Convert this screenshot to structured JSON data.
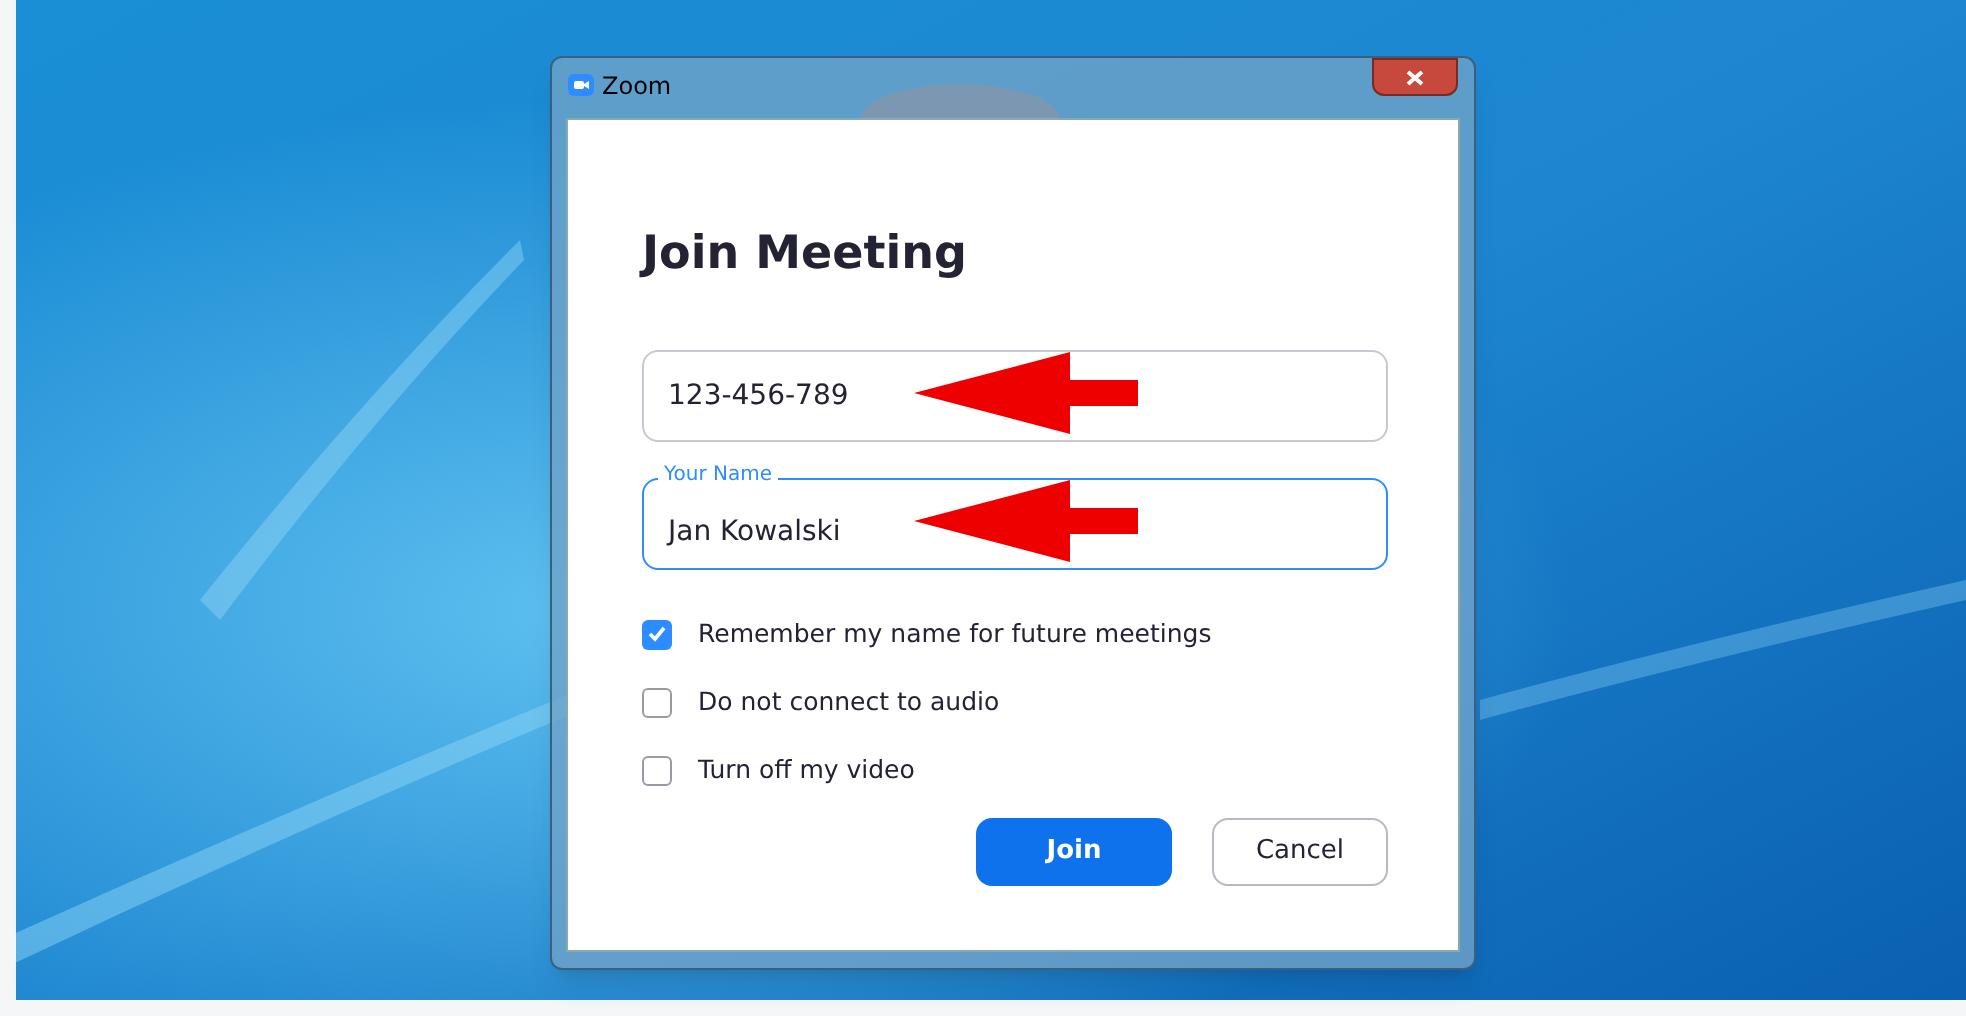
{
  "window": {
    "title": "Zoom"
  },
  "heading": "Join Meeting",
  "fields": [
    {
      "kind": "plain",
      "value": "123-456-789",
      "focused": false
    },
    {
      "kind": "labeled",
      "label": "Your Name",
      "value": "Jan Kowalski",
      "focused": true
    }
  ],
  "options": [
    {
      "label": "Remember my name for future meetings",
      "checked": true
    },
    {
      "label": "Do not connect to audio",
      "checked": false
    },
    {
      "label": "Turn off my video",
      "checked": false
    }
  ],
  "buttons": [
    {
      "label": "Join",
      "kind": "primary"
    },
    {
      "label": "Cancel",
      "kind": "secondary"
    }
  ],
  "annotations": [
    {
      "kind": "arrow"
    },
    {
      "kind": "arrow"
    }
  ]
}
